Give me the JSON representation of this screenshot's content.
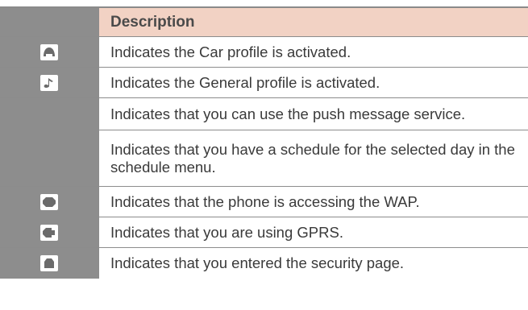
{
  "table": {
    "header": {
      "description": "Description"
    },
    "rows": [
      {
        "icon": "car-profile-icon",
        "text": "Indicates the Car profile is activated."
      },
      {
        "icon": "general-profile-icon",
        "text": "Indicates the General profile is activated."
      },
      {
        "icon": "",
        "text": "Indicates that you can use the push message service."
      },
      {
        "icon": "",
        "text": "Indicates that you have a schedule for the selected day in the schedule menu."
      },
      {
        "icon": "wap-access-icon",
        "text": "Indicates that the phone is accessing the WAP."
      },
      {
        "icon": "gprs-icon",
        "text": "Indicates that you are using GPRS."
      },
      {
        "icon": "security-icon",
        "text": "Indicates that you entered the security page."
      }
    ]
  }
}
